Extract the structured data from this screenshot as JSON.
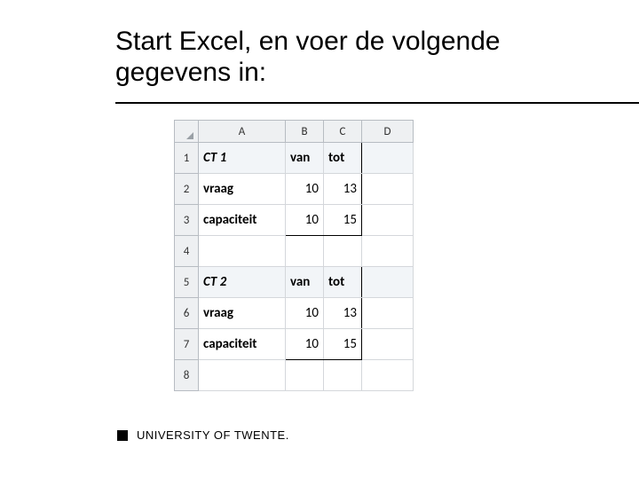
{
  "title": "Start Excel, en voer de volgende gegevens in:",
  "columns": {
    "a": "A",
    "b": "B",
    "c": "C",
    "d": "D"
  },
  "rows": {
    "r1": {
      "num": "1",
      "a": "CT 1",
      "b": "van",
      "c": "tot",
      "d": ""
    },
    "r2": {
      "num": "2",
      "a": "vraag",
      "b": "10",
      "c": "13",
      "d": ""
    },
    "r3": {
      "num": "3",
      "a": "capaciteit",
      "b": "10",
      "c": "15",
      "d": ""
    },
    "r4": {
      "num": "4",
      "a": "",
      "b": "",
      "c": "",
      "d": ""
    },
    "r5": {
      "num": "5",
      "a": "CT 2",
      "b": "van",
      "c": "tot",
      "d": ""
    },
    "r6": {
      "num": "6",
      "a": "vraag",
      "b": "10",
      "c": "13",
      "d": ""
    },
    "r7": {
      "num": "7",
      "a": "capaciteit",
      "b": "10",
      "c": "15",
      "d": ""
    },
    "r8": {
      "num": "8",
      "a": "",
      "b": "",
      "c": "",
      "d": ""
    }
  },
  "footer": {
    "university": "UNIVERSITY OF TWENTE."
  },
  "chart_data": {
    "type": "table",
    "columns": [
      "A",
      "B",
      "C",
      "D"
    ],
    "rows": [
      [
        "CT 1",
        "van",
        "tot",
        ""
      ],
      [
        "vraag",
        10,
        13,
        ""
      ],
      [
        "capaciteit",
        10,
        15,
        ""
      ],
      [
        "",
        "",
        "",
        ""
      ],
      [
        "CT 2",
        "van",
        "tot",
        ""
      ],
      [
        "vraag",
        10,
        13,
        ""
      ],
      [
        "capaciteit",
        10,
        15,
        ""
      ],
      [
        "",
        "",
        "",
        ""
      ]
    ]
  }
}
